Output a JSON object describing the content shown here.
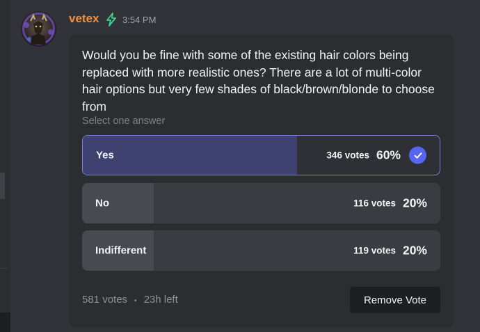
{
  "message": {
    "username": "vetex",
    "timestamp": "3:54 PM",
    "username_color": "#f0903a",
    "badge_icon": "lightning-icon"
  },
  "poll": {
    "question": "Would you be fine with some of the existing hair colors being replaced with more realistic ones? There are a lot of multi-color hair options but very few shades of black/brown/blonde to choose from",
    "subtitle": "Select one answer",
    "answers": [
      {
        "label": "Yes",
        "votes": "346 votes",
        "percent": "60%",
        "fraction": 0.6,
        "selected": true
      },
      {
        "label": "No",
        "votes": "116 votes",
        "percent": "20%",
        "fraction": 0.2,
        "selected": false
      },
      {
        "label": "Indifferent",
        "votes": "119 votes",
        "percent": "20%",
        "fraction": 0.2,
        "selected": false
      }
    ],
    "total_votes": "581 votes",
    "separator": "•",
    "time_left": "23h left",
    "remove_vote_label": "Remove Vote",
    "accent_color": "#5865f2"
  }
}
